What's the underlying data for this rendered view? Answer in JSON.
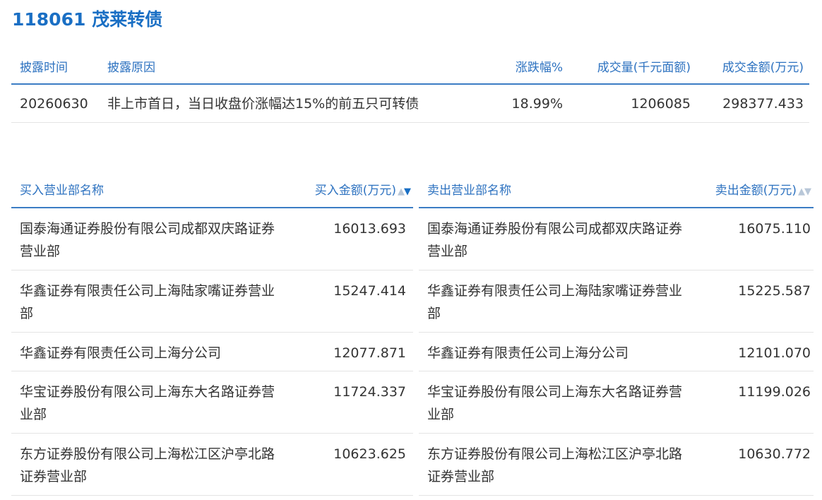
{
  "page": {
    "title": "118061 茂莱转债"
  },
  "disclosure": {
    "headers": {
      "time": "披露时间",
      "reason": "披露原因",
      "change_pct": "涨跌幅%",
      "volume": "成交量(千元面额)",
      "amount": "成交金额(万元)"
    },
    "row": {
      "time": "20260630",
      "reason": "非上市首日，当日收盘价涨幅达15%的前五只可转债",
      "change_pct": "18.99%",
      "volume": "1206085",
      "amount": "298377.433"
    }
  },
  "buy": {
    "header_name": "买入营业部名称",
    "header_amount": "买入金额(万元)",
    "sort_up": "▲",
    "sort_down": "▼",
    "rows": [
      {
        "name": "国泰海通证券股份有限公司成都双庆路证券营业部",
        "amount": "16013.693"
      },
      {
        "name": "华鑫证券有限责任公司上海陆家嘴证券营业部",
        "amount": "15247.414"
      },
      {
        "name": "华鑫证券有限责任公司上海分公司",
        "amount": "12077.871"
      },
      {
        "name": "华宝证券股份有限公司上海东大名路证券营业部",
        "amount": "11724.337"
      },
      {
        "name": "东方证券股份有限公司上海松江区沪亭北路证券营业部",
        "amount": "10623.625"
      }
    ]
  },
  "sell": {
    "header_name": "卖出营业部名称",
    "header_amount": "卖出金额(万元)",
    "sort_up": "▲",
    "sort_down": "▼",
    "rows": [
      {
        "name": "国泰海通证券股份有限公司成都双庆路证券营业部",
        "amount": "16075.110"
      },
      {
        "name": "华鑫证券有限责任公司上海陆家嘴证券营业部",
        "amount": "15225.587"
      },
      {
        "name": "华鑫证券有限责任公司上海分公司",
        "amount": "12101.070"
      },
      {
        "name": "华宝证券股份有限公司上海东大名路证券营业部",
        "amount": "11199.026"
      },
      {
        "name": "东方证券股份有限公司上海松江区沪亭北路证券营业部",
        "amount": "10630.772"
      }
    ]
  },
  "colors": {
    "accent": "#1a6fc4",
    "header_text": "#2d72c0",
    "body_text": "#333333",
    "divider": "#e4e4e4"
  }
}
